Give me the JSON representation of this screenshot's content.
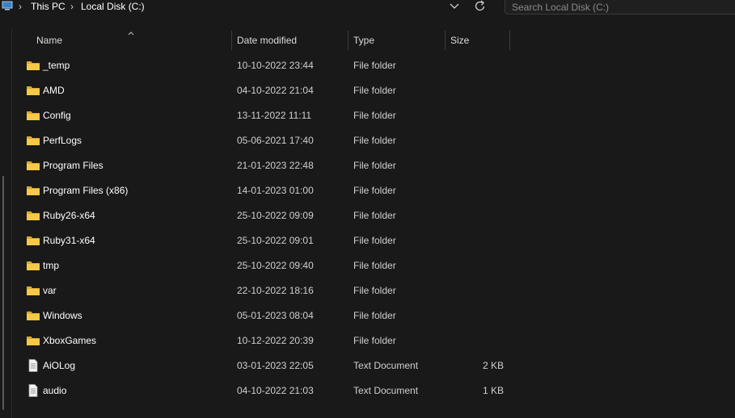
{
  "breadcrumb": {
    "items": [
      "This PC",
      "Local Disk (C:)"
    ]
  },
  "search": {
    "placeholder": "Search Local Disk (C:)"
  },
  "columns": {
    "name": "Name",
    "date_modified": "Date modified",
    "type": "Type",
    "size": "Size"
  },
  "files": [
    {
      "name": "_temp",
      "date": "10-10-2022 23:44",
      "type": "File folder",
      "size": "",
      "icon": "folder-icon"
    },
    {
      "name": "AMD",
      "date": "04-10-2022 21:04",
      "type": "File folder",
      "size": "",
      "icon": "folder-icon"
    },
    {
      "name": "Config",
      "date": "13-11-2022 11:11",
      "type": "File folder",
      "size": "",
      "icon": "folder-icon"
    },
    {
      "name": "PerfLogs",
      "date": "05-06-2021 17:40",
      "type": "File folder",
      "size": "",
      "icon": "folder-icon"
    },
    {
      "name": "Program Files",
      "date": "21-01-2023 22:48",
      "type": "File folder",
      "size": "",
      "icon": "folder-icon"
    },
    {
      "name": "Program Files (x86)",
      "date": "14-01-2023 01:00",
      "type": "File folder",
      "size": "",
      "icon": "folder-icon"
    },
    {
      "name": "Ruby26-x64",
      "date": "25-10-2022 09:09",
      "type": "File folder",
      "size": "",
      "icon": "folder-icon"
    },
    {
      "name": "Ruby31-x64",
      "date": "25-10-2022 09:01",
      "type": "File folder",
      "size": "",
      "icon": "folder-icon"
    },
    {
      "name": "tmp",
      "date": "25-10-2022 09:40",
      "type": "File folder",
      "size": "",
      "icon": "folder-icon"
    },
    {
      "name": "var",
      "date": "22-10-2022 18:16",
      "type": "File folder",
      "size": "",
      "icon": "folder-icon"
    },
    {
      "name": "Windows",
      "date": "05-01-2023 08:04",
      "type": "File folder",
      "size": "",
      "icon": "folder-icon"
    },
    {
      "name": "XboxGames",
      "date": "10-12-2022 20:39",
      "type": "File folder",
      "size": "",
      "icon": "folder-icon"
    },
    {
      "name": "AiOLog",
      "date": "03-01-2023 22:05",
      "type": "Text Document",
      "size": "2 KB",
      "icon": "text-document-icon"
    },
    {
      "name": "audio",
      "date": "04-10-2022 21:03",
      "type": "Text Document",
      "size": "1 KB",
      "icon": "text-document-icon"
    }
  ],
  "colors": {
    "background": "#191919",
    "folder": "#f4c542",
    "text": "#ffffff"
  }
}
